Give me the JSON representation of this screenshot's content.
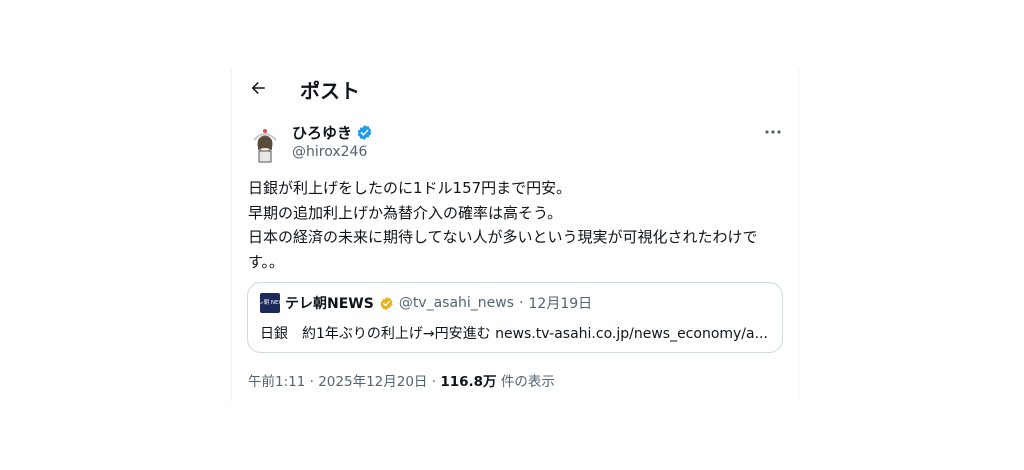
{
  "header": {
    "title": "ポスト"
  },
  "author": {
    "display_name": "ひろゆき",
    "handle": "@hirox246"
  },
  "post": {
    "text": "日銀が利上げをしたのに1ドル157円まで円安。\n早期の追加利上げか為替介入の確率は高そう。\n日本の経済の未来に期待してない人が多いという現実が可視化されたわけです。。"
  },
  "quote": {
    "avatar_text": "テレ朝 NEWS",
    "display_name": "テレ朝NEWS",
    "handle": "@tv_asahi_news",
    "separator": "·",
    "date": "12月19日",
    "text": "日銀　約1年ぶりの利上げ→円安進む news.tv-asahi.co.jp/news_economy/a..."
  },
  "meta": {
    "time": "午前1:11",
    "separator": "·",
    "date": "2025年12月20日",
    "views_count": "116.8万",
    "views_label": "件の表示"
  },
  "colors": {
    "verified_blue": "#1d9bf0",
    "verified_gold": "#e8b21a",
    "secondary_text": "#536471"
  }
}
